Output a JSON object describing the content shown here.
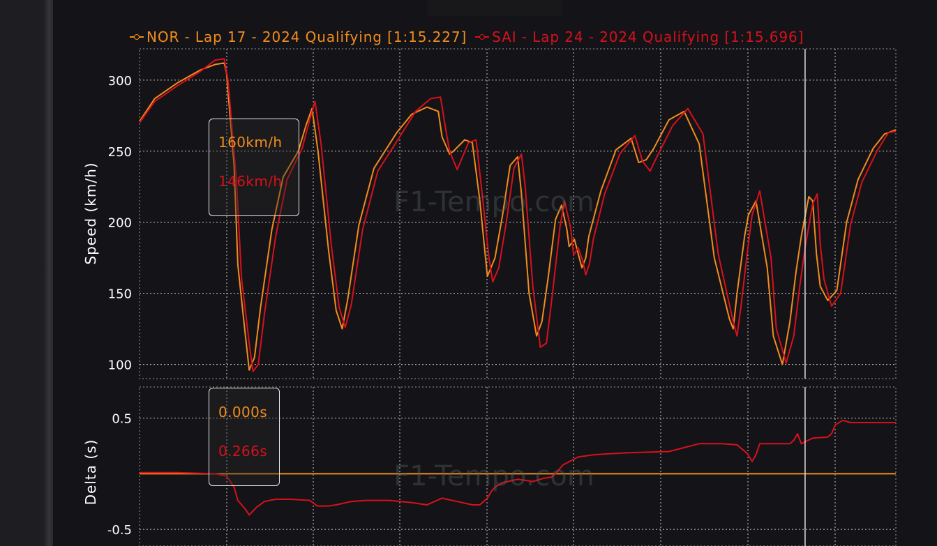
{
  "legend": [
    {
      "label": "NOR - Lap 17 - 2024 Qualifying [1:15.227]",
      "color": "#f28c1c"
    },
    {
      "label": "SAI - Lap 24 - 2024 Qualifying [1:15.696]",
      "color": "#d8101c"
    }
  ],
  "watermark": "F1-Tempo.com",
  "tooltip_speed": {
    "nor": "160km/h",
    "sai": "146km/h"
  },
  "tooltip_delta": {
    "nor": "0.000s",
    "sai": "0.266s"
  },
  "colors": {
    "nor": "#f28c1c",
    "sai": "#d8101c",
    "background": "#141418",
    "grid": "#bfbfbf"
  },
  "chart_data": [
    {
      "type": "line",
      "ylabel": "Speed (km/h)",
      "xlabel": "",
      "yticks": [
        100,
        150,
        200,
        250,
        300
      ],
      "ylim": [
        90,
        322
      ],
      "xlim": [
        0,
        1
      ],
      "grid": true,
      "cursor_x": 0.88,
      "series": [
        {
          "name": "NOR - Lap 17 - 2024 Qualifying [1:15.227]",
          "color": "#f28c1c",
          "x": [
            0,
            0.02,
            0.05,
            0.08,
            0.1,
            0.112,
            0.115,
            0.125,
            0.13,
            0.14,
            0.145,
            0.152,
            0.16,
            0.175,
            0.19,
            0.21,
            0.22,
            0.228,
            0.236,
            0.25,
            0.26,
            0.268,
            0.275,
            0.29,
            0.31,
            0.34,
            0.36,
            0.38,
            0.395,
            0.4,
            0.41,
            0.415,
            0.43,
            0.44,
            0.45,
            0.458,
            0.46,
            0.47,
            0.48,
            0.49,
            0.5,
            0.505,
            0.515,
            0.525,
            0.532,
            0.54,
            0.55,
            0.558,
            0.565,
            0.568,
            0.575,
            0.58,
            0.585,
            0.59,
            0.594,
            0.61,
            0.63,
            0.65,
            0.66,
            0.67,
            0.68,
            0.7,
            0.72,
            0.74,
            0.76,
            0.78,
            0.785,
            0.79,
            0.8,
            0.805,
            0.815,
            0.83,
            0.838,
            0.85,
            0.86,
            0.868,
            0.875,
            0.885,
            0.89,
            0.895,
            0.9,
            0.91,
            0.922,
            0.935,
            0.95,
            0.97,
            0.985,
            1.0
          ],
          "y": [
            271,
            287,
            298,
            307,
            311,
            312,
            305,
            240,
            170,
            120,
            96,
            105,
            140,
            195,
            232,
            250,
            268,
            280,
            250,
            180,
            138,
            125,
            145,
            198,
            238,
            263,
            276,
            281,
            278,
            260,
            248,
            250,
            258,
            256,
            215,
            172,
            162,
            175,
            205,
            240,
            246,
            220,
            150,
            120,
            130,
            160,
            202,
            212,
            195,
            183,
            188,
            178,
            168,
            175,
            190,
            222,
            251,
            259,
            242,
            244,
            252,
            272,
            278,
            255,
            175,
            132,
            125,
            150,
            190,
            205,
            215,
            168,
            120,
            100,
            130,
            165,
            190,
            218,
            215,
            178,
            155,
            145,
            152,
            200,
            230,
            252,
            262,
            265
          ]
        },
        {
          "name": "SAI - Lap 24 - 2024 Qualifying [1:15.696]",
          "color": "#d8101c",
          "x": [
            0,
            0.02,
            0.05,
            0.08,
            0.1,
            0.112,
            0.117,
            0.128,
            0.135,
            0.145,
            0.15,
            0.157,
            0.165,
            0.18,
            0.195,
            0.215,
            0.225,
            0.232,
            0.24,
            0.254,
            0.264,
            0.272,
            0.28,
            0.295,
            0.315,
            0.345,
            0.365,
            0.385,
            0.398,
            0.405,
            0.41,
            0.42,
            0.435,
            0.445,
            0.453,
            0.462,
            0.467,
            0.475,
            0.485,
            0.495,
            0.505,
            0.51,
            0.52,
            0.53,
            0.538,
            0.546,
            0.556,
            0.562,
            0.57,
            0.574,
            0.58,
            0.586,
            0.59,
            0.595,
            0.6,
            0.615,
            0.635,
            0.655,
            0.665,
            0.675,
            0.685,
            0.705,
            0.725,
            0.745,
            0.765,
            0.785,
            0.79,
            0.795,
            0.805,
            0.81,
            0.82,
            0.835,
            0.842,
            0.855,
            0.865,
            0.873,
            0.88,
            0.89,
            0.896,
            0.9,
            0.905,
            0.915,
            0.927,
            0.94,
            0.955,
            0.975,
            0.99,
            1.0
          ],
          "y": [
            270,
            285,
            296,
            306,
            314,
            315,
            300,
            230,
            160,
            115,
            95,
            100,
            135,
            190,
            230,
            252,
            272,
            285,
            255,
            182,
            140,
            126,
            142,
            195,
            236,
            261,
            278,
            287,
            288,
            265,
            250,
            237,
            256,
            258,
            220,
            175,
            158,
            168,
            200,
            238,
            248,
            225,
            155,
            112,
            115,
            150,
            197,
            215,
            196,
            177,
            182,
            173,
            163,
            171,
            188,
            220,
            248,
            261,
            243,
            236,
            247,
            268,
            280,
            262,
            178,
            130,
            120,
            140,
            185,
            205,
            222,
            175,
            125,
            101,
            120,
            155,
            182,
            213,
            220,
            185,
            160,
            141,
            150,
            198,
            228,
            250,
            263,
            264
          ]
        }
      ]
    },
    {
      "type": "line",
      "ylabel": "Delta (s)",
      "xlabel": "",
      "yticks": [
        0.5,
        -0.5
      ],
      "ylim": [
        -0.65,
        0.78
      ],
      "xlim": [
        0,
        1
      ],
      "grid": true,
      "cursor_x": 0.88,
      "series": [
        {
          "name": "NOR - Lap 17 - 2024 Qualifying [1:15.227]",
          "color": "#f28c1c",
          "x": [
            0,
            1
          ],
          "y": [
            0,
            0
          ]
        },
        {
          "name": "SAI - Lap 24 - 2024 Qualifying [1:15.696]",
          "color": "#d8101c",
          "x": [
            0,
            0.05,
            0.1,
            0.115,
            0.125,
            0.13,
            0.14,
            0.145,
            0.155,
            0.165,
            0.18,
            0.2,
            0.225,
            0.235,
            0.25,
            0.26,
            0.28,
            0.3,
            0.33,
            0.36,
            0.38,
            0.4,
            0.42,
            0.44,
            0.45,
            0.46,
            0.465,
            0.47,
            0.48,
            0.5,
            0.52,
            0.535,
            0.545,
            0.55,
            0.56,
            0.58,
            0.6,
            0.62,
            0.65,
            0.7,
            0.74,
            0.77,
            0.79,
            0.804,
            0.81,
            0.815,
            0.82,
            0.84,
            0.86,
            0.865,
            0.87,
            0.875,
            0.89,
            0.91,
            0.915,
            0.92,
            0.93,
            0.94,
            0.96,
            1.0
          ],
          "y": [
            0.01,
            0.01,
            0.0,
            -0.02,
            -0.12,
            -0.24,
            -0.32,
            -0.37,
            -0.3,
            -0.25,
            -0.23,
            -0.23,
            -0.24,
            -0.29,
            -0.29,
            -0.28,
            -0.25,
            -0.24,
            -0.24,
            -0.26,
            -0.28,
            -0.22,
            -0.25,
            -0.28,
            -0.28,
            -0.22,
            -0.16,
            -0.12,
            -0.08,
            -0.05,
            -0.07,
            -0.04,
            -0.03,
            0.0,
            0.08,
            0.15,
            0.17,
            0.18,
            0.19,
            0.2,
            0.27,
            0.27,
            0.26,
            0.18,
            0.11,
            0.17,
            0.27,
            0.27,
            0.27,
            0.3,
            0.36,
            0.27,
            0.32,
            0.33,
            0.36,
            0.44,
            0.48,
            0.46,
            0.46,
            0.46
          ]
        }
      ]
    }
  ]
}
